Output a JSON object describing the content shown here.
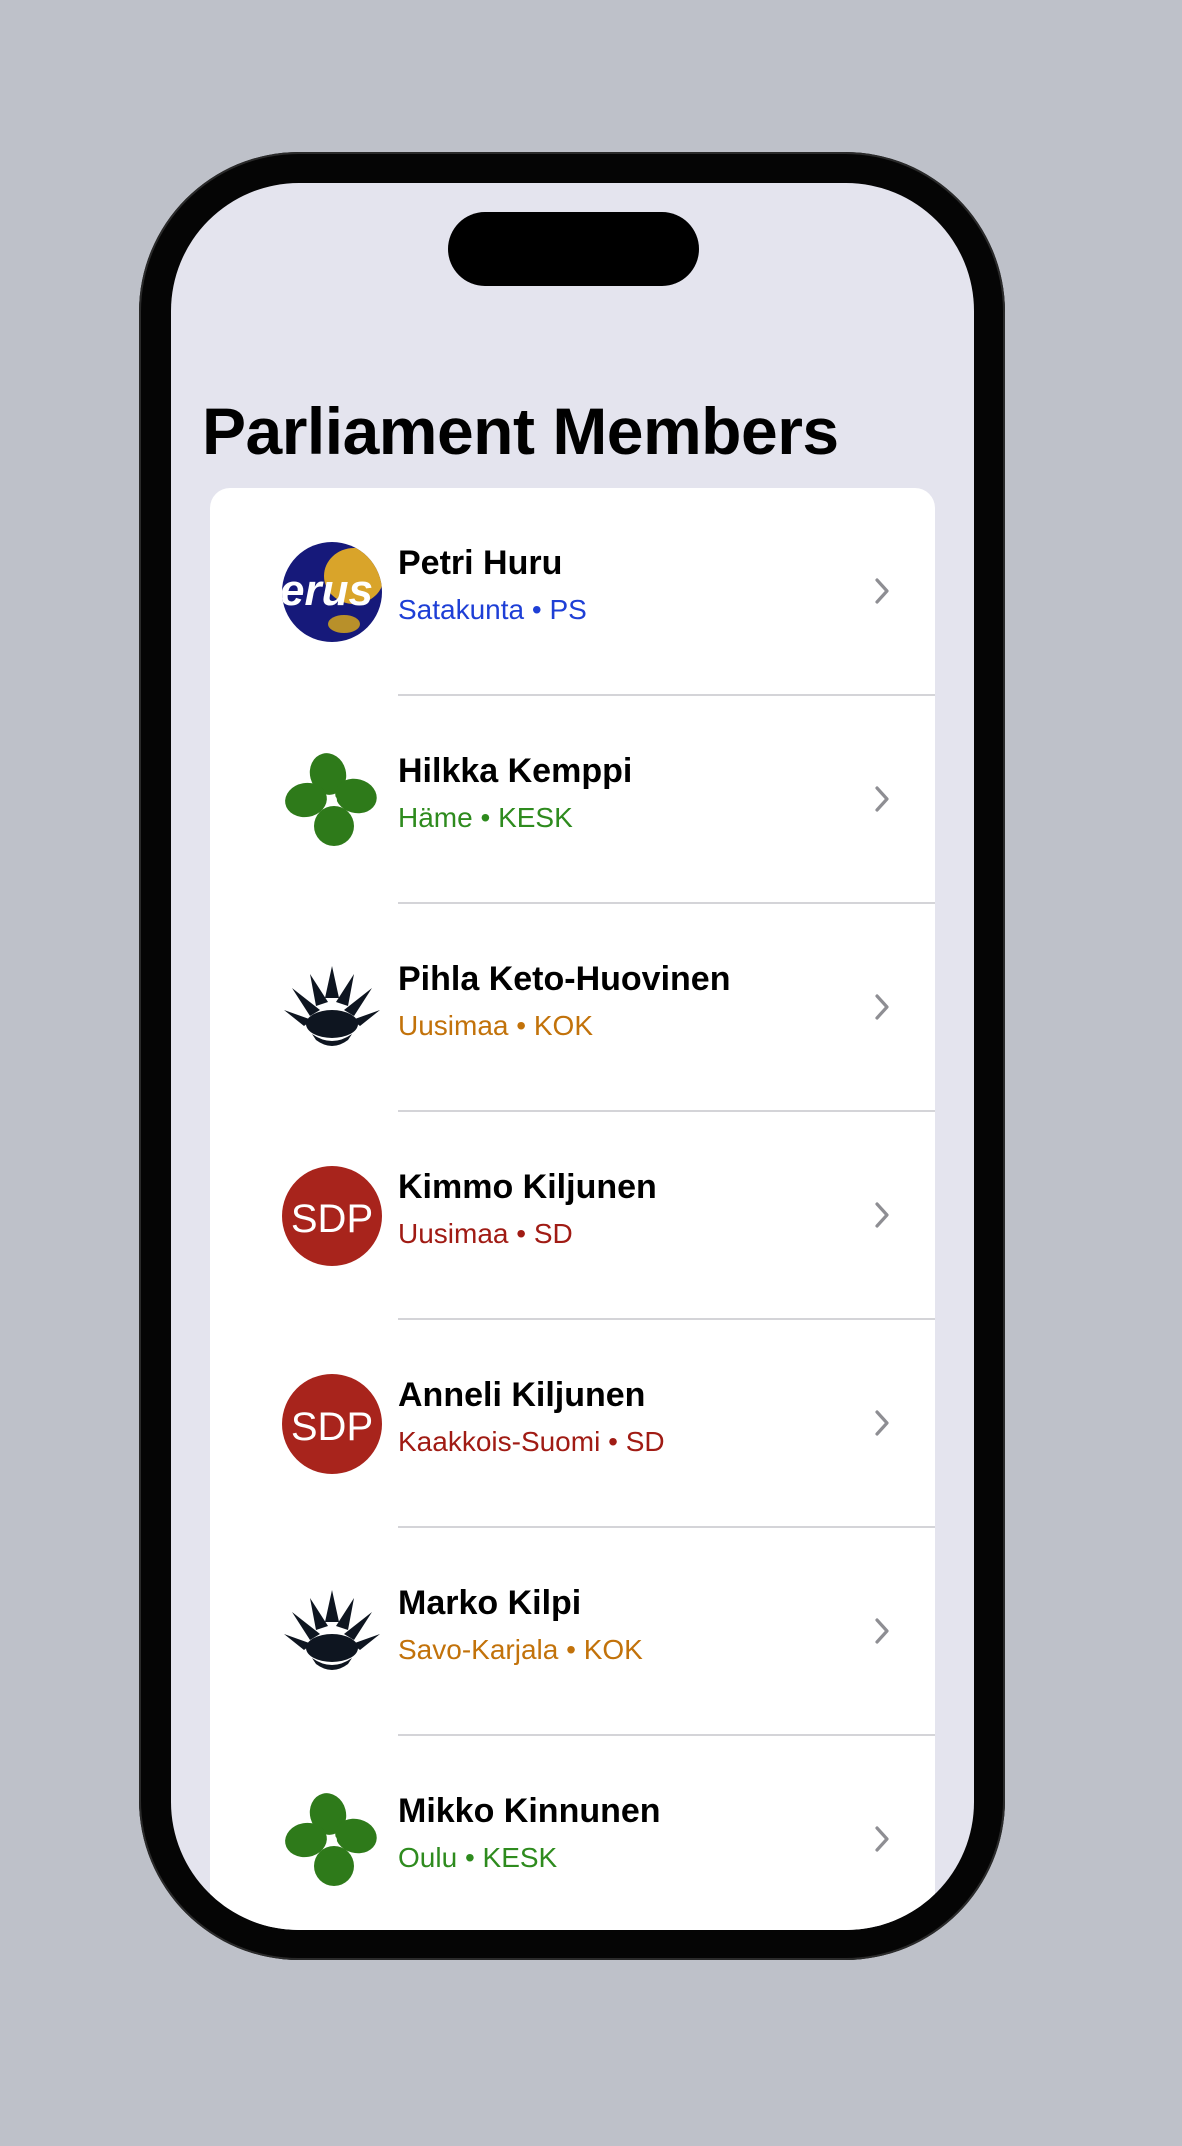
{
  "screen_title": "Parliament Members",
  "members": [
    {
      "name": "Petri Huru",
      "region": "Satakunta",
      "separator_dot": "•",
      "party": "PS",
      "accent_color": "#1e3fd6",
      "logo": "ps-logo-icon",
      "logo_text": "erus"
    },
    {
      "name": "Hilkka Kemppi",
      "region": "Häme",
      "separator_dot": "•",
      "party": "KESK",
      "accent_color": "#2e8b1e",
      "logo": "kesk-clover-icon"
    },
    {
      "name": "Pihla Keto-Huovinen",
      "region": "Uusimaa",
      "separator_dot": "•",
      "party": "KOK",
      "accent_color": "#c2720a",
      "logo": "kok-flower-icon"
    },
    {
      "name": "Kimmo Kiljunen",
      "region": "Uusimaa",
      "separator_dot": "•",
      "party": "SD",
      "accent_color": "#a01b14",
      "logo": "sdp-logo-icon",
      "logo_text": "SDP"
    },
    {
      "name": "Anneli Kiljunen",
      "region": "Kaakkois-Suomi",
      "separator_dot": "•",
      "party": "SD",
      "accent_color": "#a01b14",
      "logo": "sdp-logo-icon",
      "logo_text": "SDP"
    },
    {
      "name": "Marko Kilpi",
      "region": "Savo-Karjala",
      "separator_dot": "•",
      "party": "KOK",
      "accent_color": "#c2720a",
      "logo": "kok-flower-icon"
    },
    {
      "name": "Mikko Kinnunen",
      "region": "Oulu",
      "separator_dot": "•",
      "party": "KESK",
      "accent_color": "#2e8b1e",
      "logo": "kesk-clover-icon"
    }
  ],
  "chevron_icon": "chevron-right-icon"
}
